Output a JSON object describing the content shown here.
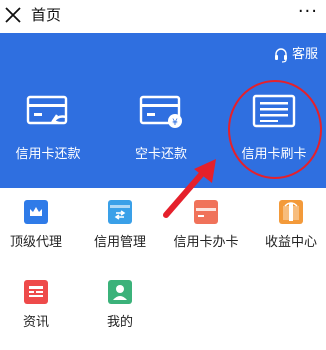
{
  "header": {
    "title": "首页",
    "more_label": "···"
  },
  "banner": {
    "service_label": "客服",
    "items": [
      {
        "label": "信用卡还款",
        "icon": "card-repay-icon"
      },
      {
        "label": "空卡还款",
        "icon": "empty-card-repay-icon"
      },
      {
        "label": "信用卡刷卡",
        "icon": "card-swipe-icon"
      }
    ],
    "color": "#2f6fe0"
  },
  "menu": {
    "items": [
      {
        "label": "顶级代理",
        "icon": "crown-icon",
        "color": "#2f7be8"
      },
      {
        "label": "信用管理",
        "icon": "credit-card-icon",
        "color": "#3aa0e8"
      },
      {
        "label": "信用卡办卡",
        "icon": "card-apply-icon",
        "color": "#f0725a"
      },
      {
        "label": "收益中心",
        "icon": "earnings-icon",
        "color": "#f39a3a"
      },
      {
        "label": "资讯",
        "icon": "news-icon",
        "color": "#ee4a4a"
      },
      {
        "label": "我的",
        "icon": "user-icon",
        "color": "#3bb27a"
      }
    ]
  },
  "annotation": {
    "circle_color": "#e5202b",
    "arrow_color": "#e5202b"
  }
}
